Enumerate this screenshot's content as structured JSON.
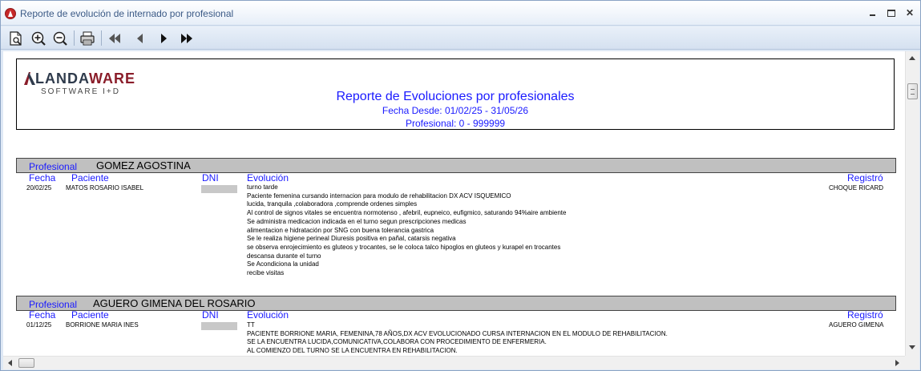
{
  "window": {
    "title": "Reporte de evolución de internado por profesional",
    "controls": {
      "close": "✕"
    }
  },
  "toolbar": {
    "buttons": [
      "preview-icon",
      "zoom-in-icon",
      "zoom-out-icon",
      "print-icon",
      "first-page-icon",
      "prev-page-icon",
      "next-page-icon",
      "last-page-icon"
    ]
  },
  "report": {
    "logo": {
      "brand_part1": "LANDA",
      "brand_part2": "WARE",
      "tagline": "SOFTWARE I+D"
    },
    "title": "Reporte de Evoluciones por profesionales",
    "date_range": "Fecha Desde: 01/02/25 - 31/05/26",
    "professional_range": "Profesional: 0 - 999999",
    "columns": {
      "fecha": "Fecha",
      "paciente": "Paciente",
      "dni": "DNI",
      "evolucion": "Evolución",
      "registro": "Registró"
    },
    "professional_label": "Profesional",
    "groups": [
      {
        "professional": "GOMEZ AGOSTINA",
        "rows": [
          {
            "fecha": "20/02/25",
            "paciente": "MATOS ROSARIO ISABEL",
            "dni": "",
            "registro": "CHOQUE RICARD",
            "evolucion": [
              "turno tarde",
              "Paciente femenina cursando internacion para modulo de rehabilitacion DX ACV ISQUEMICO",
              "lucida, tranquila ,colaboradora ,comprende ordenes simples",
              "Al control de signos vitales se encuentra normotenso , afebril, eupneico, eufigmico, saturando 94%aire ambiente",
              "Se administra medicacion indicada en el turno segun prescripciones medicas",
              "alimentacion e hidratación  por SNG con buena tolerancia gastrica",
              "Se le realiza higiene perineal Diuresis positiva en pañal,  catarsis negativa",
              "se observa enrojecimiento es gluteos y trocantes, se le coloca talco hipoglos en gluteos y kurapel en trocantes",
              "descansa durante el turno",
              "Se Acondiciona la unidad",
              "recibe visitas"
            ]
          }
        ]
      },
      {
        "professional": "AGUERO GIMENA DEL ROSARIO",
        "rows": [
          {
            "fecha": "01/12/25",
            "paciente": "BORRIONE MARIA INES",
            "dni": "",
            "registro": "AGUERO GIMENA",
            "evolucion": [
              "TT",
              "PACIENTE BORRIONE MARIA, FEMENINA,78 AÑOS,DX ACV EVOLUCIONADO CURSA INTERNACION EN EL MODULO DE REHABILITACION.",
              "SE LA ENCUENTRA LUCIDA,COMUNICATIVA,COLABORA CON PROCEDIMIENTO DE ENFERMERIA.",
              "AL COMIENZO DEL TURNO SE LA ENCUENTRA EN REHABILITACION."
            ]
          }
        ]
      }
    ]
  }
}
